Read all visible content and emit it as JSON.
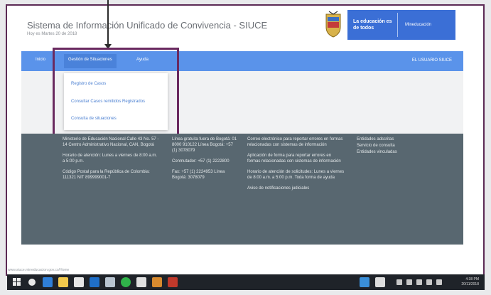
{
  "header": {
    "title": "Sistema de Información Unificado de Convivencia - SIUCE",
    "date": "Hoy es Martes 20 de 2018"
  },
  "logo": {
    "main": "La educación es de todos",
    "sub": "Mineducación"
  },
  "nav": {
    "items": [
      "Inicio",
      "Gestión de Situaciones",
      "Ayuda"
    ],
    "user": "EL USUARIO SIUCE"
  },
  "dropdown": {
    "items": [
      "Registro de Casos",
      "Consultar Casos remitidos Registrados",
      "Consulta de situaciones"
    ]
  },
  "footer": {
    "col1": [
      "Ministerio de Educación Nacional Calle 43 No. 57 - 14 Centro Administrativo Nacional, CAN, Bogotá",
      "Horario de atención: Lunes a viernes de 8:00 a.m. a 5:00 p.m.",
      "Código Postal para la República de Colombia: 111321 NIT 899999001-7"
    ],
    "col2": [
      "Línea gratuita fuera de Bogotá: 01 8000 910122 Línea Bogotá: +57 (1) 3078079",
      "Conmutador: +57 (1) 2222800",
      "Fax: +57 (1) 2224953 Línea Bogotá: 3078079"
    ],
    "col3": [
      "Correo electrónico para reportar errores en formas relacionadas con sistemas de información",
      "Aplicación de forma para reportar errores en formas relacionadas con sistemas de información",
      "Horario de atención de solicitudes: Lunes a viernes de 8:00 a.m. a 5:00 p.m. Toda forma de ayuda",
      "Aviso de notificaciones judiciales"
    ],
    "col4": [
      "Entidades adscritas",
      "Servicio de consulta",
      "Entidades vinculadas"
    ]
  },
  "status_url": "www.siuce.mineducacion.gov.co/Home",
  "tray": {
    "time": "4:38 PM",
    "date": "20/11/2018"
  }
}
